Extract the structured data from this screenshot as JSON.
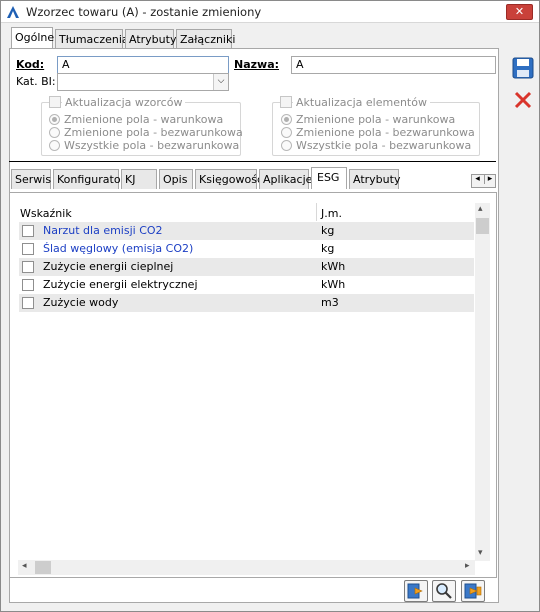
{
  "window": {
    "title": "Wzorzec towaru (A) - zostanie zmieniony",
    "close_label": "✕"
  },
  "top_tabs": [
    "Ogólne",
    "Tłumaczenia",
    "Atrybuty",
    "Załączniki"
  ],
  "form": {
    "kod_label": "Kod:",
    "kod_value": "A",
    "nazwa_label": "Nazwa:",
    "nazwa_value": "A",
    "katbi_label": "Kat. BI:",
    "katbi_value": ""
  },
  "group_wzorcow": {
    "title": "Aktualizacja wzorców",
    "options": [
      "Zmienione pola - warunkowa",
      "Zmienione pola - bezwarunkowa",
      "Wszystkie pola - bezwarunkowa"
    ]
  },
  "group_elementow": {
    "title": "Aktualizacja elementów",
    "options": [
      "Zmienione pola - warunkowa",
      "Zmienione pola - bezwarunkowa",
      "Wszystkie pola - bezwarunkowa"
    ]
  },
  "sub_tabs": [
    "Serwis",
    "Konfigurator",
    "KJ",
    "Opis",
    "Księgowość",
    "Aplikacje",
    "ESG",
    "Atrybuty"
  ],
  "grid": {
    "col_name": "Wskaźnik",
    "col_unit": "J.m.",
    "rows": [
      {
        "name": "Narzut dla emisji CO2",
        "unit": "kg"
      },
      {
        "name": "Ślad węglowy (emisja CO2)",
        "unit": "kg"
      },
      {
        "name": "Zużycie energii cieplnej",
        "unit": "kWh"
      },
      {
        "name": "Zużycie energii elektrycznej",
        "unit": "kWh"
      },
      {
        "name": "Zużycie wody",
        "unit": "m3"
      }
    ]
  },
  "colors": {
    "link": "#1c3fc4",
    "accent": "#1e5fb4",
    "close": "#c9413a"
  },
  "icons": {
    "save": "save-icon",
    "cancel": "cancel-icon",
    "add": "add-from-list-icon",
    "search": "search-icon",
    "change": "change-icon"
  }
}
